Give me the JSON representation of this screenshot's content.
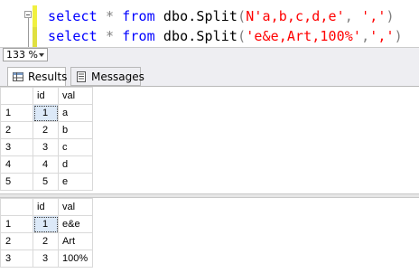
{
  "editor": {
    "line1": {
      "kw1": "select",
      "star": "*",
      "kw2": "from",
      "obj": "dbo.Split",
      "open": "(",
      "str1": "N'a,b,c,d,e'",
      "comma": ", ",
      "str2": "','",
      "close": ")"
    },
    "line2": {
      "kw1": "select",
      "star": "*",
      "kw2": "from",
      "obj": "dbo.Split",
      "open": "(",
      "str1": "'e&e,Art,100%'",
      "comma": ",",
      "str2": "','",
      "close": ")"
    }
  },
  "zoom": {
    "value": "133 %"
  },
  "tabs": {
    "results": "Results",
    "messages": "Messages"
  },
  "grid1": {
    "columns": [
      "",
      "id",
      "val"
    ],
    "rows": [
      [
        "1",
        "1",
        "a"
      ],
      [
        "2",
        "2",
        "b"
      ],
      [
        "3",
        "3",
        "c"
      ],
      [
        "4",
        "4",
        "d"
      ],
      [
        "5",
        "5",
        "e"
      ]
    ]
  },
  "grid2": {
    "columns": [
      "",
      "id",
      "val"
    ],
    "rows": [
      [
        "1",
        "1",
        "e&e"
      ],
      [
        "2",
        "2",
        "Art"
      ],
      [
        "3",
        "3",
        "100%"
      ]
    ]
  },
  "colors": {
    "keyword": "#0000ff",
    "string": "#ff0000",
    "operator": "#808080",
    "selected_cell": "#dce9f8"
  }
}
